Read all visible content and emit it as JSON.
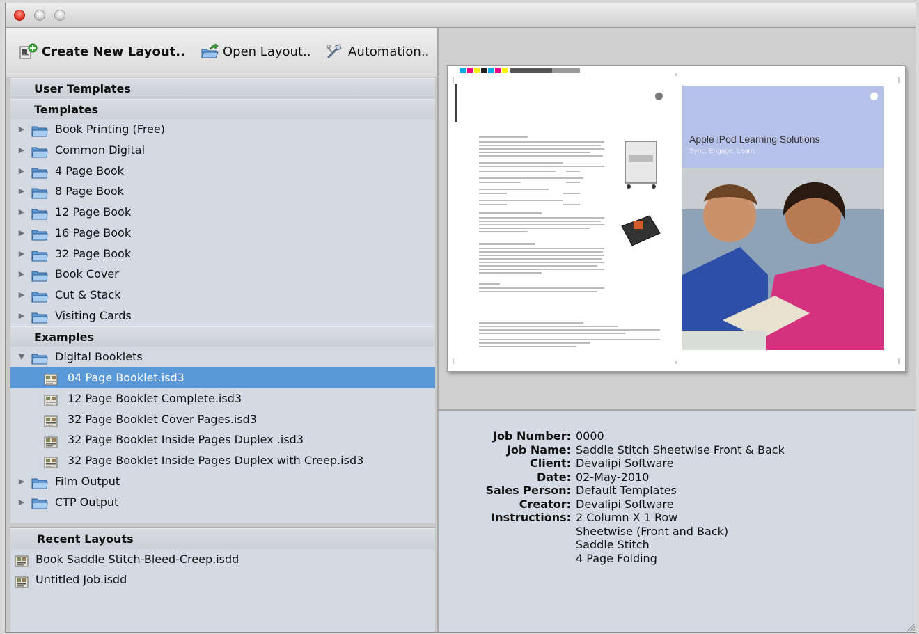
{
  "toolbar": {
    "create_label": "Create New Layout..",
    "open_label": "Open Layout..",
    "automation_label": "Automation.."
  },
  "tree": {
    "user_templates_header": "User Templates",
    "templates_header": "Templates",
    "templates": [
      "Book Printing (Free)",
      "Common Digital",
      "4 Page Book",
      "8 Page Book",
      "12 Page Book",
      "16 Page Book",
      "32 Page Book",
      "Book Cover",
      "Cut & Stack",
      "Visiting Cards"
    ],
    "examples_header": "Examples",
    "digital_booklets_label": "Digital Booklets",
    "digital_booklets_files": [
      "04 Page Booklet.isd3",
      "12 Page Booklet Complete.isd3",
      "32 Page Booklet Cover Pages.isd3",
      "32 Page Booklet Inside Pages Duplex .isd3",
      "32 Page Booklet Inside Pages Duplex with Creep.isd3"
    ],
    "selected_file": "04 Page Booklet.isd3",
    "film_output_label": "Film Output",
    "ctp_output_label": "CTP Output"
  },
  "recent": {
    "header": "Recent Layouts",
    "items": [
      "Book Saddle Stitch-Bleed-Creep.isdd",
      "Untitled Job.isdd"
    ]
  },
  "preview": {
    "headline": "Apple iPod Learning Solutions",
    "tagline": "Sync. Engage. Learn."
  },
  "job_info": {
    "job_number_label": "Job Number:",
    "job_number": "0000",
    "job_name_label": "Job Name:",
    "job_name": "Saddle Stitch Sheetwise Front & Back",
    "client_label": "Client:",
    "client": "Devalipi Software",
    "date_label": "Date:",
    "date": "02-May-2010",
    "sales_person_label": "Sales Person:",
    "sales_person": "Default Templates",
    "creator_label": "Creator:",
    "creator": "Devalipi Software",
    "instructions_label": "Instructions:",
    "instructions": [
      "2 Column X 1 Row",
      "Sheetwise (Front and Back)",
      "Saddle Stitch",
      "4 Page Folding"
    ]
  },
  "colors": {
    "selection": "#5a98d8",
    "list_background": "#d3dae3",
    "folder_blue": "#6fa8e0",
    "preview_panel": "#b5c1e8",
    "close_red": "#e0271a"
  },
  "icons": [
    "create-layout-icon",
    "open-layout-icon",
    "automation-icon",
    "folder-icon",
    "disclosure-triangle-icon",
    "layout-file-icon",
    "resize-grip-icon"
  ]
}
